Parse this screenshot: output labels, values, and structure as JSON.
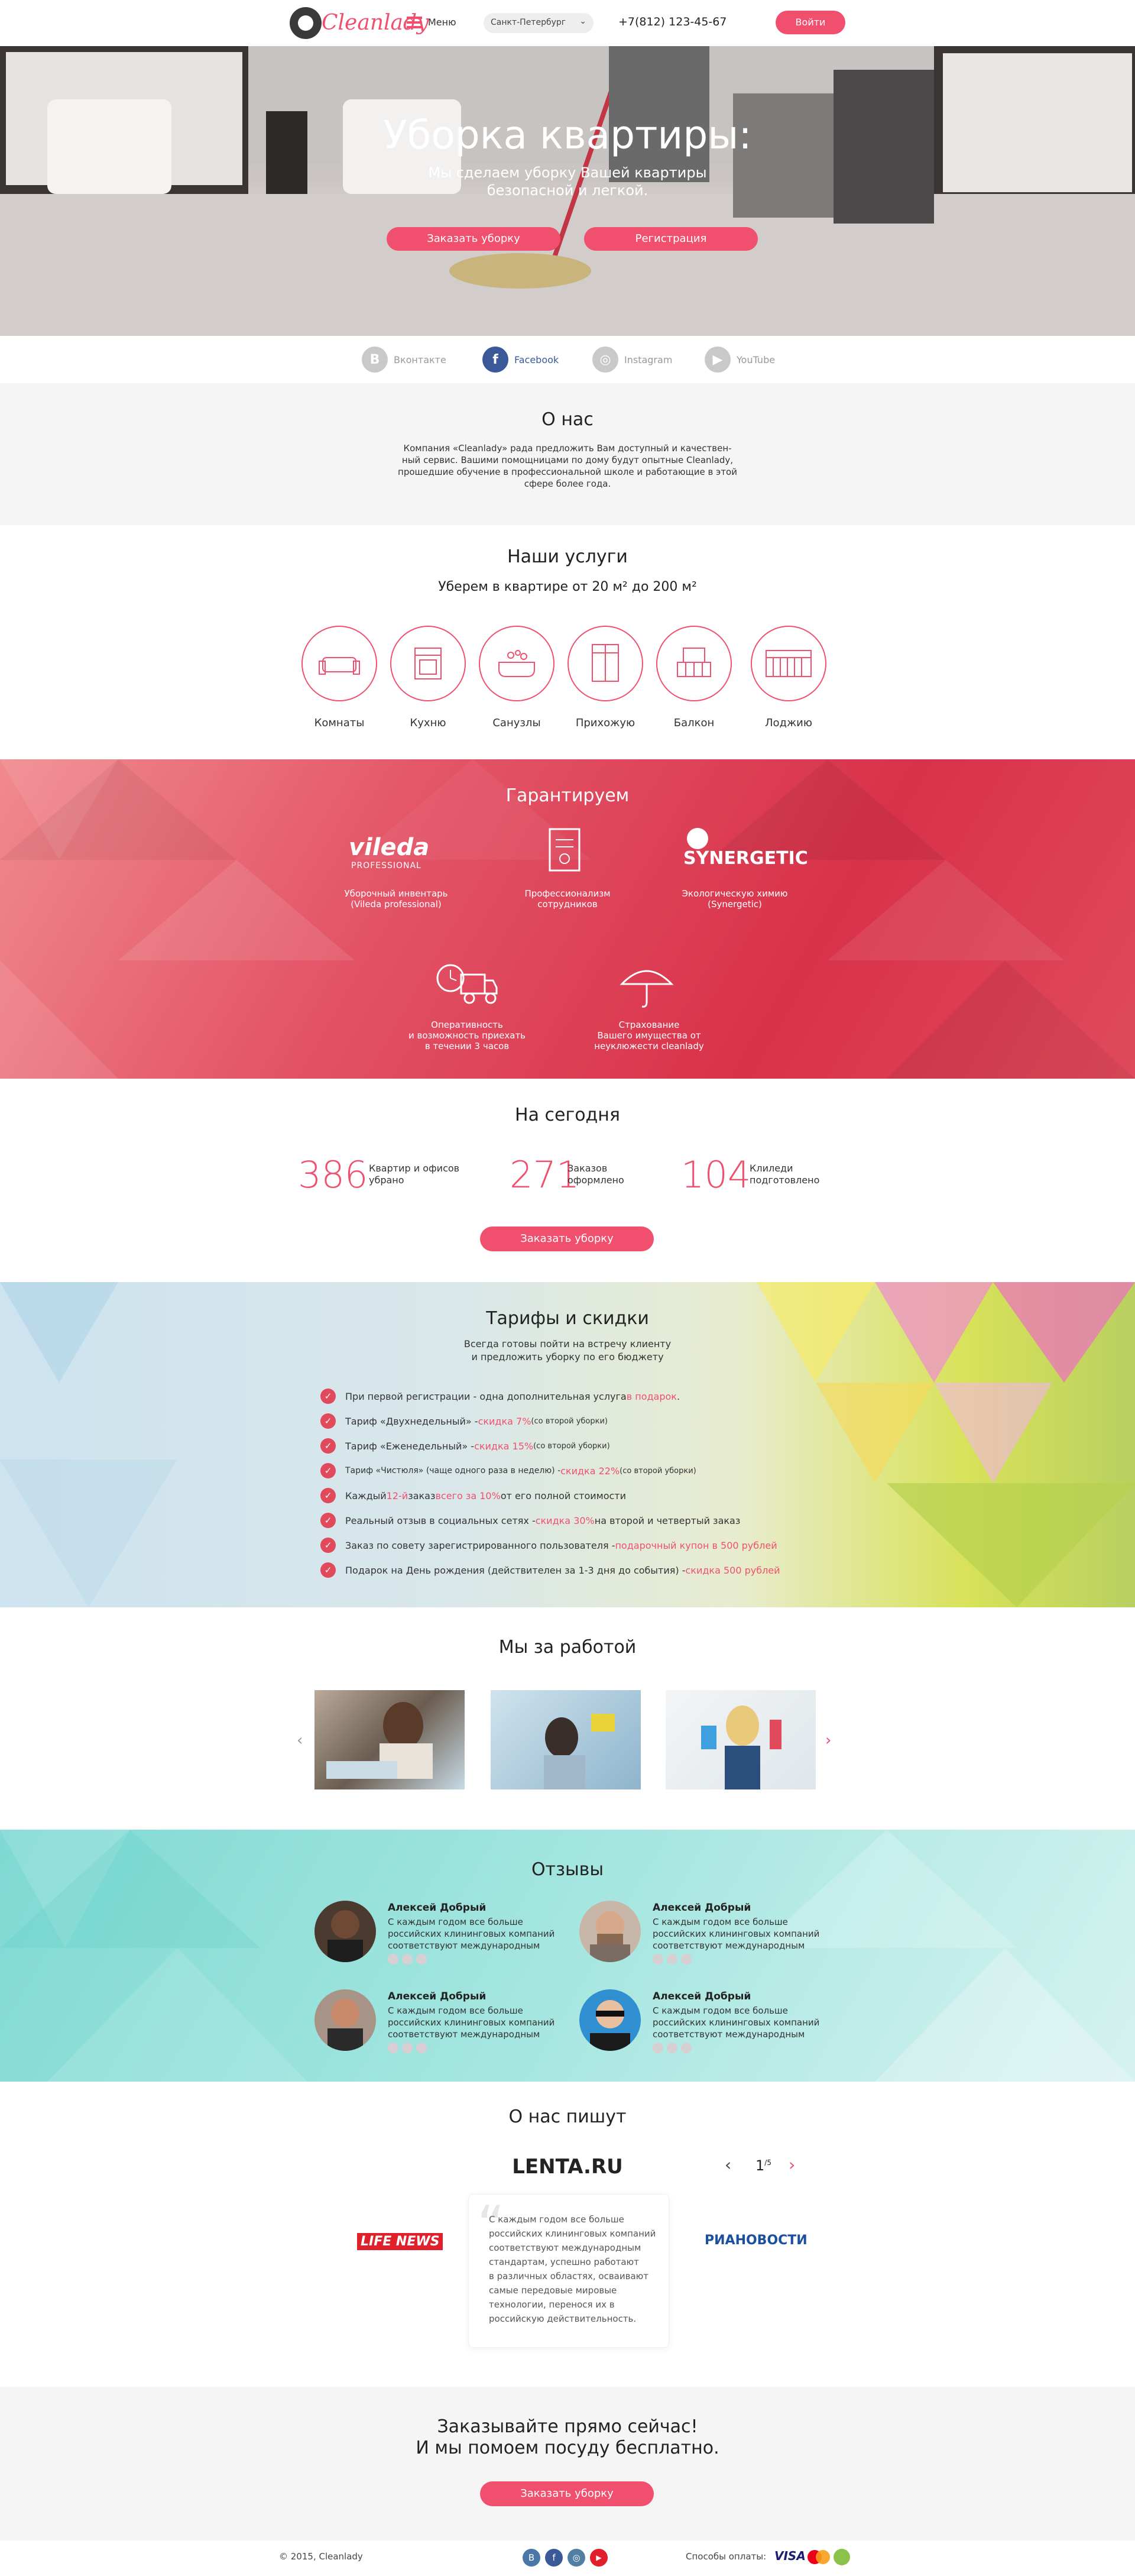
{
  "header": {
    "logo": "Cleanlady",
    "menu": "Меню",
    "city": "Санкт-Петербург",
    "phone": "+7(812) 123-45-67",
    "login": "Войти"
  },
  "hero": {
    "title": "Уборка квартиры:",
    "subtitle_1": "Мы сделаем уборку Вашей квартиры",
    "subtitle_2": "безопасной и легкой.",
    "order": "Заказать уборку",
    "register": "Регистрация"
  },
  "social": [
    {
      "name": "Вконтакте",
      "letter": "B",
      "color": "#c9c9c9",
      "text": "#999"
    },
    {
      "name": "Facebook",
      "letter": "f",
      "color": "#3b5998",
      "text": "#3b5998"
    },
    {
      "name": "Instagram",
      "letter": "◎",
      "color": "#c9c9c9",
      "text": "#999"
    },
    {
      "name": "YouTube",
      "letter": "▶",
      "color": "#c9c9c9",
      "text": "#999"
    }
  ],
  "about": {
    "title": "О нас",
    "lines": [
      "Компания «Cleanlady» рада предложить Вам доступный и качествен-",
      "ный сервис. Вашими помощницами по дому будут опытные Cleanlady,",
      "прошедшие обучение в профессиональной школе и работающие в этой",
      "сфере более года."
    ]
  },
  "services": {
    "title": "Наши услуги",
    "subtitle": "Уберем  в квартире от 20 м² до 200 м²",
    "items": [
      {
        "label": "Комнаты",
        "icon": "sofa-icon"
      },
      {
        "label": "Кухню",
        "icon": "stove-icon"
      },
      {
        "label": "Санузлы",
        "icon": "bathtub-icon"
      },
      {
        "label": "Прихожую",
        "icon": "wardrobe-icon"
      },
      {
        "label": "Балкон",
        "icon": "balcony-icon"
      },
      {
        "label": "Лоджию",
        "icon": "loggia-icon"
      }
    ]
  },
  "guarantee": {
    "title": "Гарантируем",
    "vileda": "vileda",
    "vileda_sub": "PROFESSIONAL",
    "synergetic": "SYNERGETIC",
    "items": [
      {
        "l1": "Уборочный инвентарь",
        "l2": "(Vileda professional)",
        "l3": ""
      },
      {
        "l1": "Профессионализм",
        "l2": "сотрудников",
        "l3": ""
      },
      {
        "l1": "Экологическую химию",
        "l2": "(Synergetic)",
        "l3": ""
      },
      {
        "l1": "Оперативность",
        "l2": "и возможность приехать",
        "l3": "в течении 3 часов"
      },
      {
        "l1": "Страхование",
        "l2": "Вашего имущества от",
        "l3": "неуклюжести cleanlady"
      }
    ]
  },
  "today": {
    "title": "На сегодня",
    "stats": [
      {
        "num": "386",
        "l1": "Квартир и офисов",
        "l2": "убрано"
      },
      {
        "num": "271",
        "l1": "Заказов",
        "l2": "оформлено"
      },
      {
        "num": "104",
        "l1": "Клиледи",
        "l2": "подготовлено"
      }
    ],
    "order": "Заказать уборку"
  },
  "tariffs": {
    "title": "Тарифы и скидки",
    "sub1": "Всегда готовы пойти на встречу клиенту",
    "sub2": "и предложить уборку по его бюджету",
    "items": [
      {
        "a": "При первой регистрации - одна дополнительная услуга ",
        "b": "в подарок",
        "c": "."
      },
      {
        "a": "Тариф «Двухнедельный» - ",
        "b": "скидка 7%",
        "c": " (со второй уборки)"
      },
      {
        "a": "Тариф «Еженедельный» - ",
        "b": "скидка 15%",
        "c": " (со второй уборки)"
      },
      {
        "a": "Тариф «Чистюля» (чаще одного раза в неделю) - ",
        "b": "скидка 22%",
        "c": " (со второй уборки)"
      },
      {
        "a": "Каждый ",
        "b": "12-й",
        "c": " заказ ",
        "d": "всего за 10%",
        "e": " от его полной стоимости"
      },
      {
        "a": "Реальный отзыв в социальных сетях - ",
        "b": "скидка 30%",
        "c": " на второй и четвертый заказ"
      },
      {
        "a": "Заказ по совету зарегистрированного пользователя - ",
        "b": "подарочный купон в 500 рублей",
        "c": ""
      },
      {
        "a": "Подарок на День рождения (действителен за 1-3 дня до события) - ",
        "b": "скидка 500 рублей",
        "c": ""
      }
    ]
  },
  "work": {
    "title": "Мы за работой"
  },
  "reviews": {
    "title": "Отзывы",
    "items": [
      {
        "name": "Алексей Добрый",
        "l1": "С каждым годом все больше",
        "l2": "российских клининговых компаний",
        "l3": "соответствуют международным"
      },
      {
        "name": "Алексей Добрый",
        "l1": "С каждым годом все больше",
        "l2": "российских клининговых компаний",
        "l3": "соответствуют международным"
      },
      {
        "name": "Алексей Добрый",
        "l1": "С каждым годом все больше",
        "l2": "российских клининговых компаний",
        "l3": "соответствуют международным"
      },
      {
        "name": "Алексей Добрый",
        "l1": "С каждым годом все больше",
        "l2": "российских клининговых компаний",
        "l3": "соответствуют международным"
      }
    ]
  },
  "press": {
    "title": "О нас пишут",
    "main": "LENTA.RU",
    "left": "LIFE NEWS",
    "right": "РИАНОВОСТИ",
    "page": "1",
    "total": "/5",
    "lines": [
      "С каждым годом все больше",
      "российских клининговых компаний",
      "соответствуют международным",
      "стандартам, успешно работают",
      "в различных областях, осваивают",
      "самые передовые мировые",
      "технологии, перенося их в",
      "российскую действительность."
    ]
  },
  "cta": {
    "l1": "Заказывайте прямо сейчас!",
    "l2": "И мы помоем посуду бесплатно.",
    "order": "Заказать уборку"
  },
  "footer": {
    "copy": "© 2015, Cleanlady",
    "pay": "Способы оплаты:",
    "visa": "VISA"
  }
}
